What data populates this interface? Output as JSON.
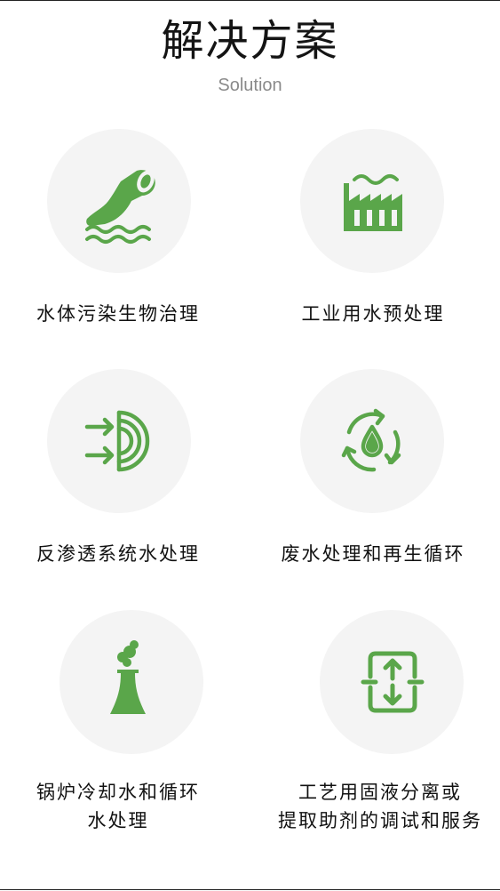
{
  "header": {
    "title": "解决方案",
    "subtitle": "Solution"
  },
  "accent_color": "#5aa64a",
  "solutions": [
    {
      "label": "水体污染生物治理",
      "icon": "sewage-pipe-icon"
    },
    {
      "label": "工业用水预处理",
      "icon": "factory-icon"
    },
    {
      "label": "反渗透系统水处理",
      "icon": "reverse-osmosis-icon"
    },
    {
      "label": "废水处理和再生循环",
      "icon": "water-recycle-icon"
    },
    {
      "label_line1": "锅炉冷却水和循环",
      "label_line2": "水处理",
      "icon": "cooling-tower-icon"
    },
    {
      "label_line1": "工艺用固液分离或",
      "label_line2": "提取助剂的调试和服务",
      "icon": "separation-icon"
    }
  ]
}
